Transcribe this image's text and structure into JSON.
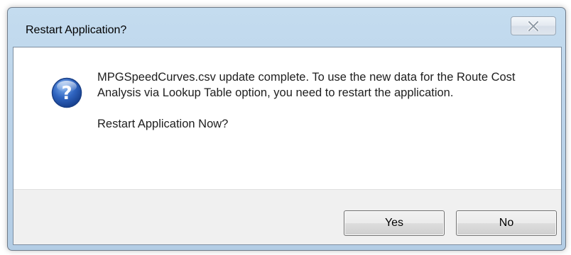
{
  "window": {
    "title": "Restart Application?",
    "close_icon": "close-x-icon"
  },
  "message": {
    "icon": "question-icon",
    "body": "MPGSpeedCurves.csv update complete. To use the new data for the Route Cost Analysis via Lookup Table option, you need to restart the application.",
    "prompt": "Restart Application Now?"
  },
  "buttons": {
    "yes_label": "Yes",
    "no_label": "No"
  },
  "colors": {
    "frame": "#bcd4ea",
    "icon_blue": "#2a5bb5",
    "footer": "#f0f0f0"
  }
}
